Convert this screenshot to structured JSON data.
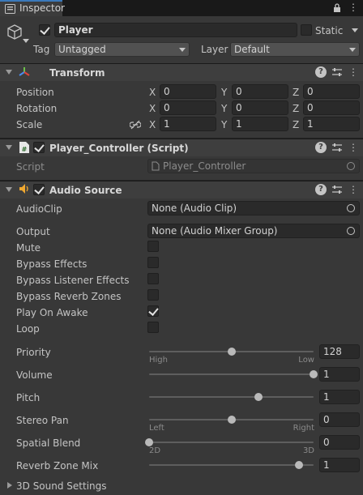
{
  "window": {
    "tab_title": "Inspector"
  },
  "object": {
    "name": "Player",
    "static_label": "Static",
    "tag_label": "Tag",
    "tag_value": "Untagged",
    "layer_label": "Layer",
    "layer_value": "Default"
  },
  "transform": {
    "title": "Transform",
    "rows": [
      {
        "label": "Position",
        "x": "0",
        "y": "0",
        "z": "0"
      },
      {
        "label": "Rotation",
        "x": "0",
        "y": "0",
        "z": "0"
      },
      {
        "label": "Scale",
        "x": "1",
        "y": "1",
        "z": "1"
      }
    ],
    "axis": {
      "x": "X",
      "y": "Y",
      "z": "Z"
    }
  },
  "script_component": {
    "title": "Player_Controller (Script)",
    "script_label": "Script",
    "script_value": "Player_Controller"
  },
  "audio_source": {
    "title": "Audio Source",
    "audioclip_label": "AudioClip",
    "audioclip_value": "None (Audio Clip)",
    "output_label": "Output",
    "output_value": "None (Audio Mixer Group)",
    "toggles": [
      {
        "label": "Mute",
        "checked": false
      },
      {
        "label": "Bypass Effects",
        "checked": false
      },
      {
        "label": "Bypass Listener Effects",
        "checked": false
      },
      {
        "label": "Bypass Reverb Zones",
        "checked": false
      },
      {
        "label": "Play On Awake",
        "checked": true
      },
      {
        "label": "Loop",
        "checked": false
      }
    ],
    "sliders": [
      {
        "label": "Priority",
        "value": "128",
        "level": 0.5,
        "left_caption": "High",
        "right_caption": "Low"
      },
      {
        "label": "Volume",
        "value": "1",
        "level": 1.0
      },
      {
        "label": "Pitch",
        "value": "1",
        "level": 0.667
      },
      {
        "label": "Stereo Pan",
        "value": "0",
        "level": 0.5,
        "left_caption": "Left",
        "right_caption": "Right"
      },
      {
        "label": "Spatial Blend",
        "value": "0",
        "level": 0.0,
        "left_caption": "2D",
        "right_caption": "3D"
      },
      {
        "label": "Reverb Zone Mix",
        "value": "1",
        "level": 0.909
      }
    ],
    "sound_settings_label": "3D Sound Settings"
  }
}
